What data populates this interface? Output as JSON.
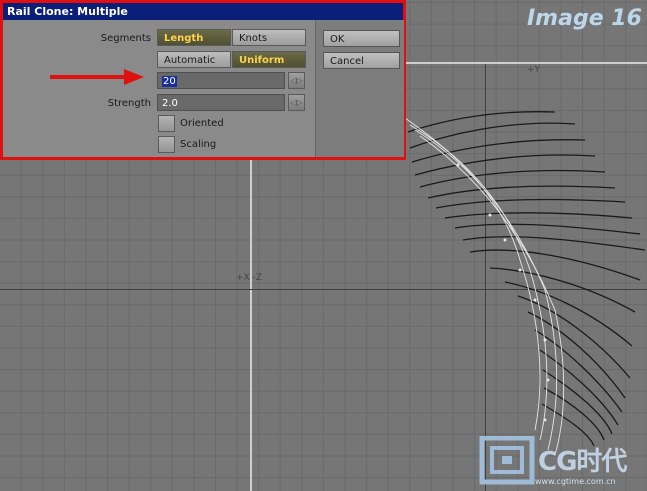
{
  "window": {
    "title": "Rail Clone: Multiple"
  },
  "image_tag": "Image 16",
  "form": {
    "segments_label": "Segments",
    "segments_options": [
      "Length",
      "Knots"
    ],
    "segments_selected": "Length",
    "mode_options": [
      "Automatic",
      "Uniform"
    ],
    "mode_selected": "Uniform",
    "count_value": "20",
    "strength_label": "Strength",
    "strength_value": "2.0",
    "oriented_label": "Oriented",
    "scaling_label": "Scaling"
  },
  "buttons": {
    "ok": "OK",
    "cancel": "Cancel"
  },
  "viewport": {
    "axis_top": "+Y",
    "axis_center": "+X -Z"
  },
  "logo": {
    "text": "CG时代",
    "url": "www.cgtime.com.cn"
  },
  "colors": {
    "dialog_border": "#e01010",
    "titlebar": "#0b1f7a",
    "active_button_text": "#ffd34a",
    "selection": "#1a2f9c"
  }
}
